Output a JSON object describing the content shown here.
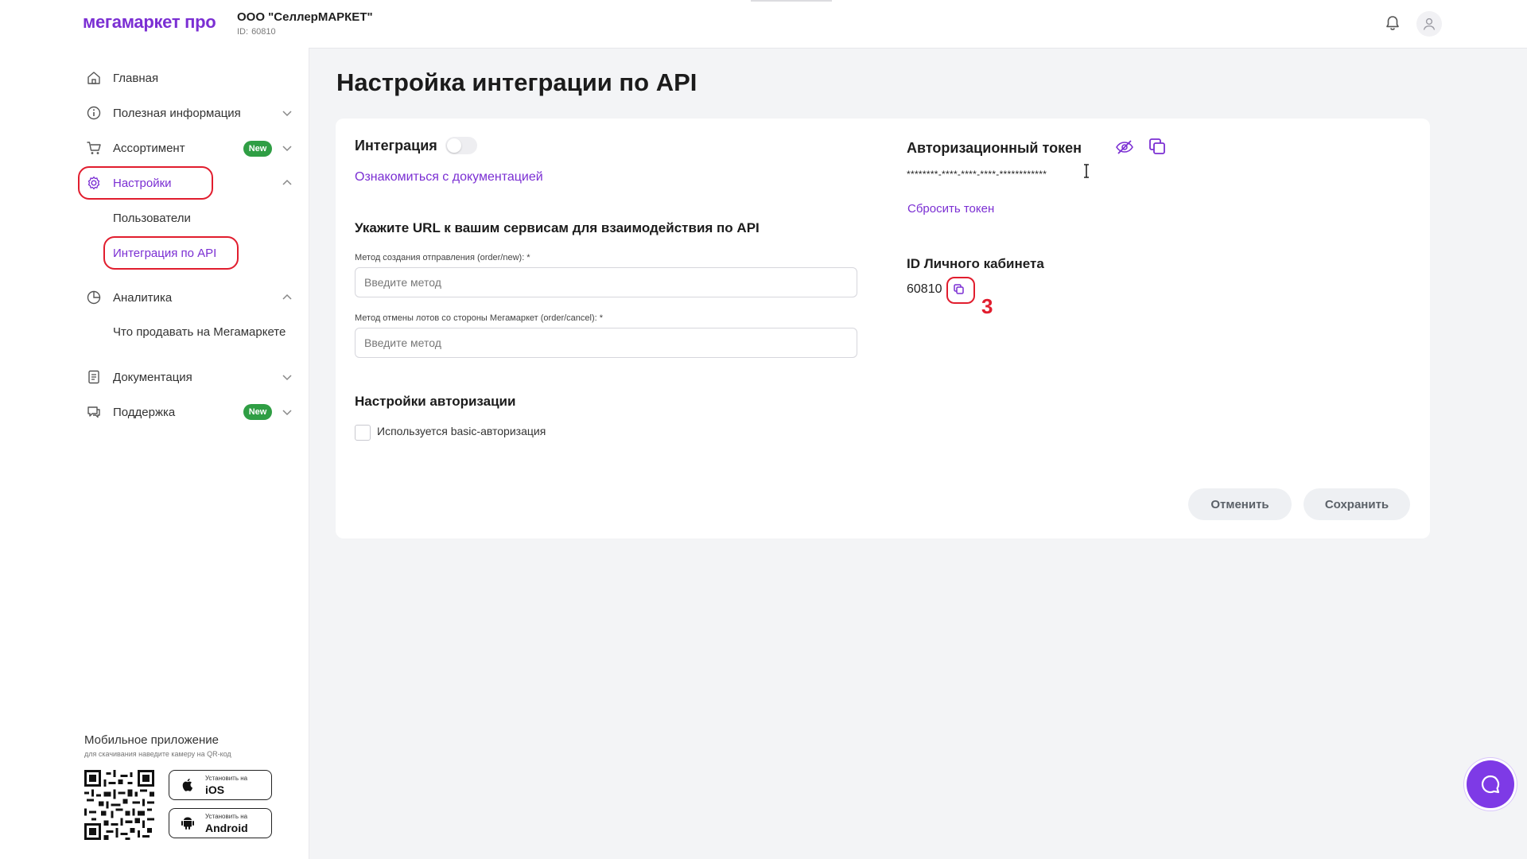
{
  "header": {
    "logo": "мегамаркет про",
    "org_name": "ООО \"СеллерМАРКЕТ\"",
    "org_id_label": "ID:",
    "org_id_value": "60810"
  },
  "sidebar": {
    "items": [
      {
        "label": "Главная",
        "icon": "home-icon"
      },
      {
        "label": "Полезная информация",
        "icon": "info-icon"
      },
      {
        "label": "Ассортимент",
        "icon": "cart-icon",
        "badge": "New"
      },
      {
        "label": "Настройки",
        "icon": "gear-icon"
      },
      {
        "label": "Аналитика",
        "icon": "chart-pie-icon"
      },
      {
        "label": "Документация",
        "icon": "document-icon"
      },
      {
        "label": "Поддержка",
        "icon": "chat-icon",
        "badge": "New"
      }
    ],
    "settings_sub": [
      "Пользователи",
      "Интеграция по API"
    ],
    "analytics_sub": [
      "Что продавать на Мегамаркете"
    ],
    "active_item": "Интеграция по API",
    "mobile": {
      "title": "Мобильное приложение",
      "subtitle": "для скачивания наведите камеру на QR-код",
      "ios_small": "Установить на",
      "ios_big": "iOS",
      "android_small": "Установить на",
      "android_big": "Android"
    }
  },
  "main": {
    "title": "Настройка интеграции по API",
    "integration_label": "Интеграция",
    "integration_enabled": false,
    "doc_link": "Ознакомиться с документацией",
    "url_section_title": "Укажите URL к вашим сервисам для взаимодействия по API",
    "field1_label": "Метод создания отправления (order/new): *",
    "field1_placeholder": "Введите метод",
    "field2_label": "Метод отмены лотов со стороны Мегамаркет (order/cancel): *",
    "field2_placeholder": "Введите метод",
    "auth_section_title": "Настройки авторизации",
    "basic_auth_label": "Используется basic-авторизация",
    "basic_auth_checked": false,
    "token_title": "Авторизационный токен",
    "token_value": "********-****-****-****-************",
    "reset_token": "Сбросить токен",
    "cabinet_id_title": "ID Личного кабинета",
    "cabinet_id_value": "60810",
    "annotation_step": "3",
    "cancel_button": "Отменить",
    "save_button": "Сохранить"
  },
  "colors": {
    "accent": "#7b2fd3",
    "badge_green": "#2f9e44",
    "annotation_red": "#e11d2e",
    "chat_fab": "#7e3ae6"
  }
}
